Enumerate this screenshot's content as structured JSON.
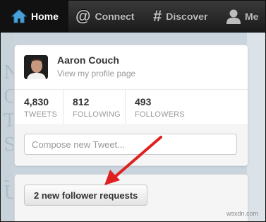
{
  "nav": {
    "items": [
      {
        "label": "Home",
        "icon": "home-icon",
        "active": true
      },
      {
        "label": "Connect",
        "icon": "at-sign-icon",
        "active": false
      },
      {
        "label": "Discover",
        "icon": "hash-icon",
        "active": false
      },
      {
        "label": "Me",
        "icon": "person-icon",
        "active": false
      }
    ]
  },
  "profile": {
    "name": "Aaron Couch",
    "link_text": "View my profile page"
  },
  "stats": [
    {
      "value": "4,830",
      "label": "TWEETS"
    },
    {
      "value": "812",
      "label": "FOLLOWING"
    },
    {
      "value": "493",
      "label": "FOLLOWERS"
    }
  ],
  "compose": {
    "placeholder": "Compose new Tweet..."
  },
  "requests": {
    "button_label": "2 new follower requests"
  },
  "watermark": "wsxdn.com",
  "colors": {
    "topbar": "#2b2b2b",
    "active_tab": "#111111",
    "accent_blue": "#4aa0d8",
    "annotation_arrow": "#e0201f"
  }
}
